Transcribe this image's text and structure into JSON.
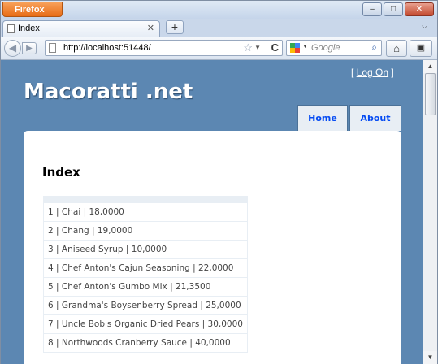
{
  "browser": {
    "app_button": "Firefox",
    "tab_title": "Index",
    "new_tab": "+",
    "url": "http://localhost:51448/",
    "search_placeholder": "Google"
  },
  "site": {
    "title": "Macoratti .net",
    "login_open": "[",
    "login_link": "Log On",
    "login_close": "]",
    "menu": [
      {
        "label": "Home"
      },
      {
        "label": "About"
      }
    ]
  },
  "main": {
    "heading": "Index",
    "rows": [
      "1 | Chai | 18,0000",
      "2 | Chang | 19,0000",
      "3 | Aniseed Syrup | 10,0000",
      "4 | Chef Anton's Cajun Seasoning | 22,0000",
      "5 | Chef Anton's Gumbo Mix | 21,3500",
      "6 | Grandma's Boysenberry Spread | 25,0000",
      "7 | Uncle Bob's Organic Dried Pears | 30,0000",
      "8 | Northwoods Cranberry Sauce | 40,0000"
    ]
  },
  "colors": {
    "page_background": "#5c87b2",
    "menu_background": "#e8eef4",
    "menu_link": "#034af3"
  }
}
